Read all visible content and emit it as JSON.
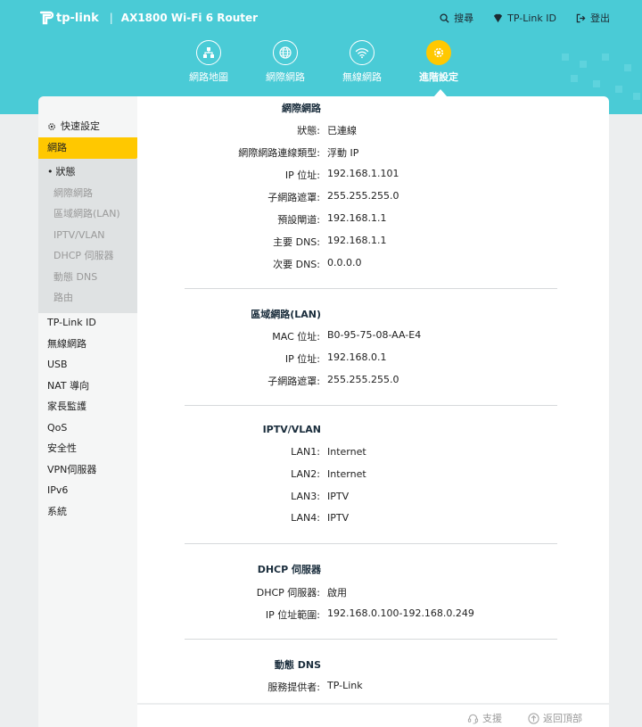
{
  "header": {
    "logo_text": "tp-link",
    "separator": "|",
    "model": "AX1800 Wi-Fi 6 Router",
    "links": [
      {
        "icon": "search-icon",
        "label": "搜尋"
      },
      {
        "icon": "tplink-id-icon",
        "label": "TP-Link ID"
      },
      {
        "icon": "logout-icon",
        "label": "登出"
      }
    ]
  },
  "nav": {
    "tabs": [
      {
        "icon": "network-map-icon",
        "label": "網路地圖"
      },
      {
        "icon": "globe-icon",
        "label": "網際網路"
      },
      {
        "icon": "wifi-icon",
        "label": "無線網路"
      },
      {
        "icon": "gear-icon",
        "label": "進階設定"
      }
    ],
    "active_index": 3
  },
  "sidebar": {
    "quick_setup": "快速設定",
    "active": "網路",
    "sub_items": [
      "狀態",
      "網際網路",
      "區域網路(LAN)",
      "IPTV/VLAN",
      "DHCP 伺服器",
      "動態 DNS",
      "路由"
    ],
    "current_sub": 0,
    "items": [
      "TP-Link ID",
      "無線網路",
      "USB",
      "NAT 導向",
      "家長監護",
      "QoS",
      "安全性",
      "VPN伺服器",
      "IPv6",
      "系統"
    ]
  },
  "sections": {
    "internet": {
      "title": "網際網路",
      "rows": [
        {
          "k": "狀態:",
          "v": "已連線"
        },
        {
          "k": "網際網路連線類型:",
          "v": "浮動 IP"
        },
        {
          "k": "IP 位址:",
          "v": "192.168.1.101"
        },
        {
          "k": "子網路遮罩:",
          "v": "255.255.255.0"
        },
        {
          "k": "預設閘道:",
          "v": "192.168.1.1"
        },
        {
          "k": "主要 DNS:",
          "v": "192.168.1.1"
        },
        {
          "k": "次要 DNS:",
          "v": "0.0.0.0"
        }
      ]
    },
    "lan": {
      "title": "區域網路(LAN)",
      "rows": [
        {
          "k": "MAC 位址:",
          "v": "B0-95-75-08-AA-E4"
        },
        {
          "k": "IP 位址:",
          "v": "192.168.0.1"
        },
        {
          "k": "子網路遮罩:",
          "v": "255.255.255.0"
        }
      ]
    },
    "iptv": {
      "title": "IPTV/VLAN",
      "rows": [
        {
          "k": "LAN1:",
          "v": "Internet"
        },
        {
          "k": "LAN2:",
          "v": "Internet"
        },
        {
          "k": "LAN3:",
          "v": "IPTV"
        },
        {
          "k": "LAN4:",
          "v": "IPTV"
        }
      ]
    },
    "dhcp": {
      "title": "DHCP 伺服器",
      "rows": [
        {
          "k": "DHCP 伺服器:",
          "v": "啟用"
        },
        {
          "k": "IP 位址範圍:",
          "v": "192.168.0.100-192.168.0.249"
        }
      ]
    },
    "ddns": {
      "title": "動態 DNS",
      "rows": [
        {
          "k": "服務提供者:",
          "v": "TP-Link"
        }
      ]
    }
  },
  "footer": {
    "support": "支援",
    "back_to_top": "返回頂部"
  },
  "colors": {
    "header_bg": "#4acbd6",
    "accent": "#ffc800"
  }
}
